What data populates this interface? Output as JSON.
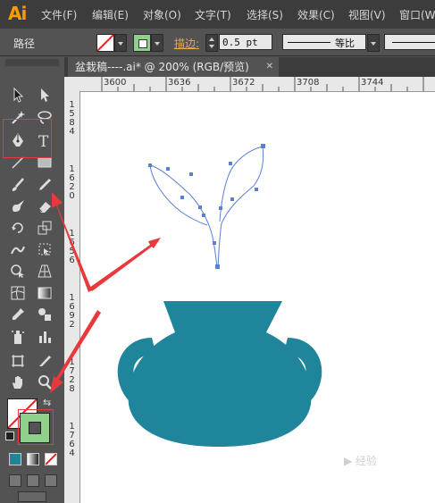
{
  "app": {
    "logo": "Ai"
  },
  "menu": [
    "文件(F)",
    "编辑(E)",
    "对象(O)",
    "文字(T)",
    "选择(S)",
    "效果(C)",
    "视图(V)",
    "窗口(W"
  ],
  "control_bar": {
    "object_label": "路径",
    "stroke_label": "描边:",
    "stroke_weight": "0.5 pt",
    "profile_label": "等比"
  },
  "tab": {
    "title": "盆栽稿----.ai* @ 200% (RGB/预览)",
    "close": "✕"
  },
  "ruler": {
    "h_labels": [
      "3600",
      "3636",
      "3672",
      "3708",
      "3744"
    ],
    "v_labels": [
      "1584",
      "1620",
      "1656",
      "1692",
      "1728",
      "1764"
    ]
  },
  "colors": {
    "pot": "#1f859b",
    "path_stroke": "#5b7fd2",
    "annotation": "#e8393d",
    "fill_swatch": "#ffffff",
    "stroke_swatch": "#8fd18a"
  },
  "tools": [
    "selection-tool",
    "direct-selection-tool",
    "magic-wand-tool",
    "lasso-tool",
    "pen-tool",
    "type-tool",
    "line-tool",
    "rectangle-tool",
    "paintbrush-tool",
    "pencil-tool",
    "blob-brush-tool",
    "eraser-tool",
    "rotate-tool",
    "scale-tool",
    "warp-tool",
    "free-transform-tool",
    "shape-builder-tool",
    "perspective-grid-tool",
    "mesh-tool",
    "gradient-tool",
    "eyedropper-tool",
    "blend-tool",
    "symbol-sprayer-tool",
    "column-graph-tool",
    "artboard-tool",
    "slice-tool",
    "hand-tool",
    "zoom-tool"
  ],
  "watermark": "▶ 经验"
}
